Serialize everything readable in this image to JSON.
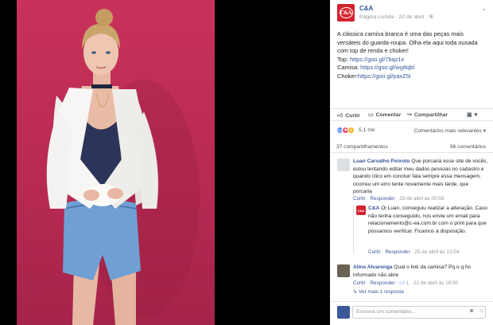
{
  "page": {
    "name": "C&A",
    "logo_text": "C&A",
    "meta": "Página curtida · 22 de abril · ",
    "menu_icon": "chevron-down-icon"
  },
  "post": {
    "lines": [
      "A clássica camisa branca é uma das peças mais versáteis do guarda-roupa. Olha ela aqui toda ousada com top de renda e choker!",
      "Top: ",
      "Camisa: ",
      "Choker:"
    ],
    "links": [
      "https://goo.gl/7bqz1x",
      "https://goo.gl/wg8qbl",
      "https://goo.gl/paxZ5i"
    ]
  },
  "actions": {
    "like": "Curtir",
    "comment": "Comentar",
    "share": "Compartilhar"
  },
  "reactions": {
    "count": "5,1 mil",
    "sort": "Comentários mais relevantes",
    "colors": {
      "like": "#5890ff",
      "love": "#f25268",
      "wow": "#f7b125"
    }
  },
  "stats": {
    "shares": "37 compartilhamentos",
    "comments": "96 comentários"
  },
  "comments": [
    {
      "name": "Luan Carvalho Peixoto",
      "text": " Que porcaria esse site de vocês, estou tentando editar meu dados pessoas no cadastro e quando clico em concluir fala sempre essa mensagem, ocorreu um erro tente novamente mais tarde, que porcaria",
      "like": "Curtir",
      "reply": "Responder",
      "time": " · 23 de abril às 00:59"
    },
    {
      "name": "C&A",
      "text": " Oi Luan, conseguiu realizar a alteração. Caso não tenha conseguido, nos envie um email para relacionamento@c-ea.com.br com o print para que possamos verificar. Ficamos à disposição.",
      "like": "Curtir",
      "reply": "Responder",
      "time": " · 25 de abril às 13:54"
    },
    {
      "name": "Aline Alvarenga",
      "text": " Qual o link da camisa? Pq o q foi informado não abre",
      "like": "Curtir",
      "reply": "Responder",
      "likes": "1",
      "time": " · 22 de abril às 18:50",
      "more": "Ver mais 1 resposta"
    }
  ],
  "composer": {
    "placeholder": "Escreva um comentário..."
  }
}
